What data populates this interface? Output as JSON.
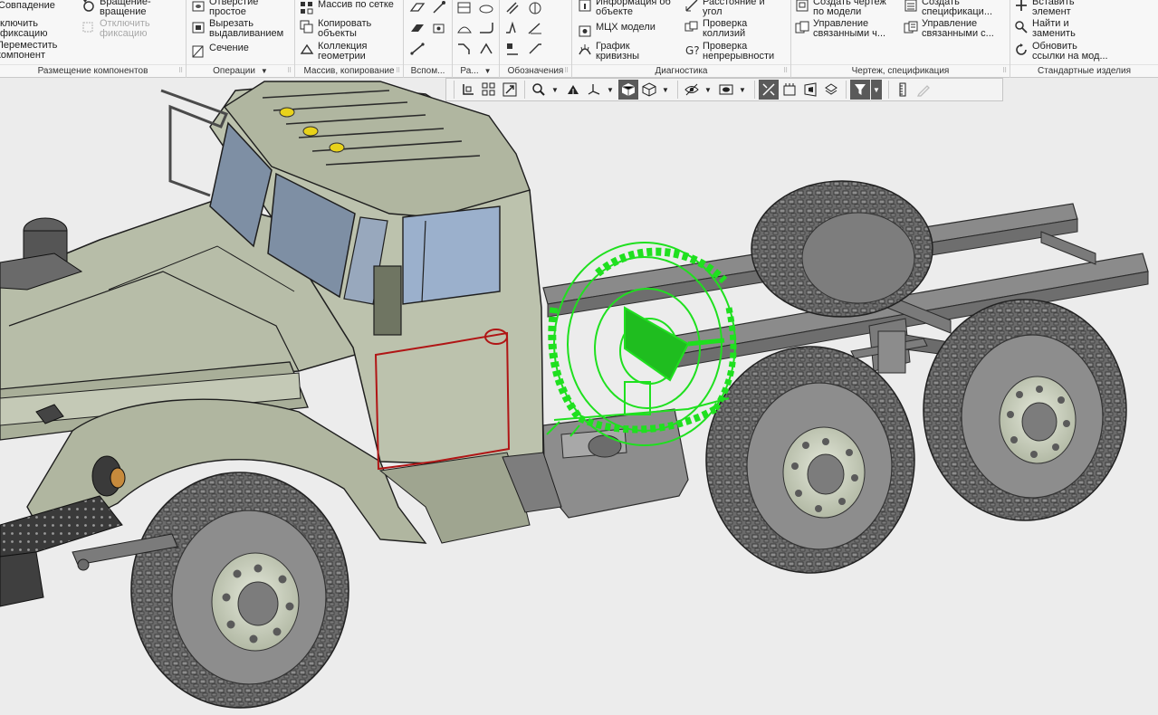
{
  "ribbon": {
    "groups": [
      {
        "label": "Размещение компонентов"
      },
      {
        "label": "Операции"
      },
      {
        "label": "Массив, копирование"
      },
      {
        "label": "Вспом..."
      },
      {
        "label": "Ра..."
      },
      {
        "label": "Обозначения"
      },
      {
        "label": "Диагностика"
      },
      {
        "label": "Чертеж, спецификация"
      },
      {
        "label": "Стандартные изделия"
      }
    ],
    "placement": {
      "coincide": "Совпадение",
      "include_fix_1": "ключить",
      "include_fix_2": "фиксацию",
      "move_1": "Переместить",
      "move_2": "компонент",
      "rot_move_1": "Вращение-",
      "rot_move_2": "вращение",
      "disable_fix_1": "Отключить",
      "disable_fix_2": "фиксацию"
    },
    "operations": {
      "hole_1": "Отверстие",
      "hole_2": "простое",
      "extrude_cut_1": "Вырезать",
      "extrude_cut_2": "выдавливанием",
      "section": "Сечение"
    },
    "array": {
      "grid_array": "Массив по сетке",
      "copy_objects_1": "Копировать",
      "copy_objects_2": "объекты",
      "geom_collection_1": "Коллекция",
      "geom_collection_2": "геометрии"
    },
    "diagnostics": {
      "object_info_1": "Информация об",
      "object_info_2": "объекте",
      "mass_props": "МЦХ модели",
      "curvature_1": "График",
      "curvature_2": "кривизны",
      "distance_1": "Расстояние и",
      "distance_2": "угол",
      "collisions_1": "Проверка",
      "collisions_2": "коллизий",
      "continuity_1": "Проверка",
      "continuity_2": "непрерывности"
    },
    "drawing": {
      "create_drawing_1": "Создать чертеж",
      "create_drawing_2": "по модели",
      "manage_linked_1": "Управление",
      "manage_linked_2": "связанными ч...",
      "create_spec_1": "Создать",
      "create_spec_2": "спецификаци...",
      "manage_spec_1": "Управление",
      "manage_spec_2": "связанными с..."
    },
    "standard": {
      "insert_1": "Вставить",
      "insert_2": "элемент",
      "find_replace_1": "Найти и",
      "find_replace_2": "заменить",
      "update_links_1": "Обновить",
      "update_links_2": "ссылки на мод..."
    }
  },
  "colors": {
    "selection": "#1fe01f",
    "body_green": "#b7bda8",
    "tire": "#606060",
    "frame": "#7a7a7a",
    "viewport_bg": "#ececec",
    "door_highlight": "#b01515"
  }
}
